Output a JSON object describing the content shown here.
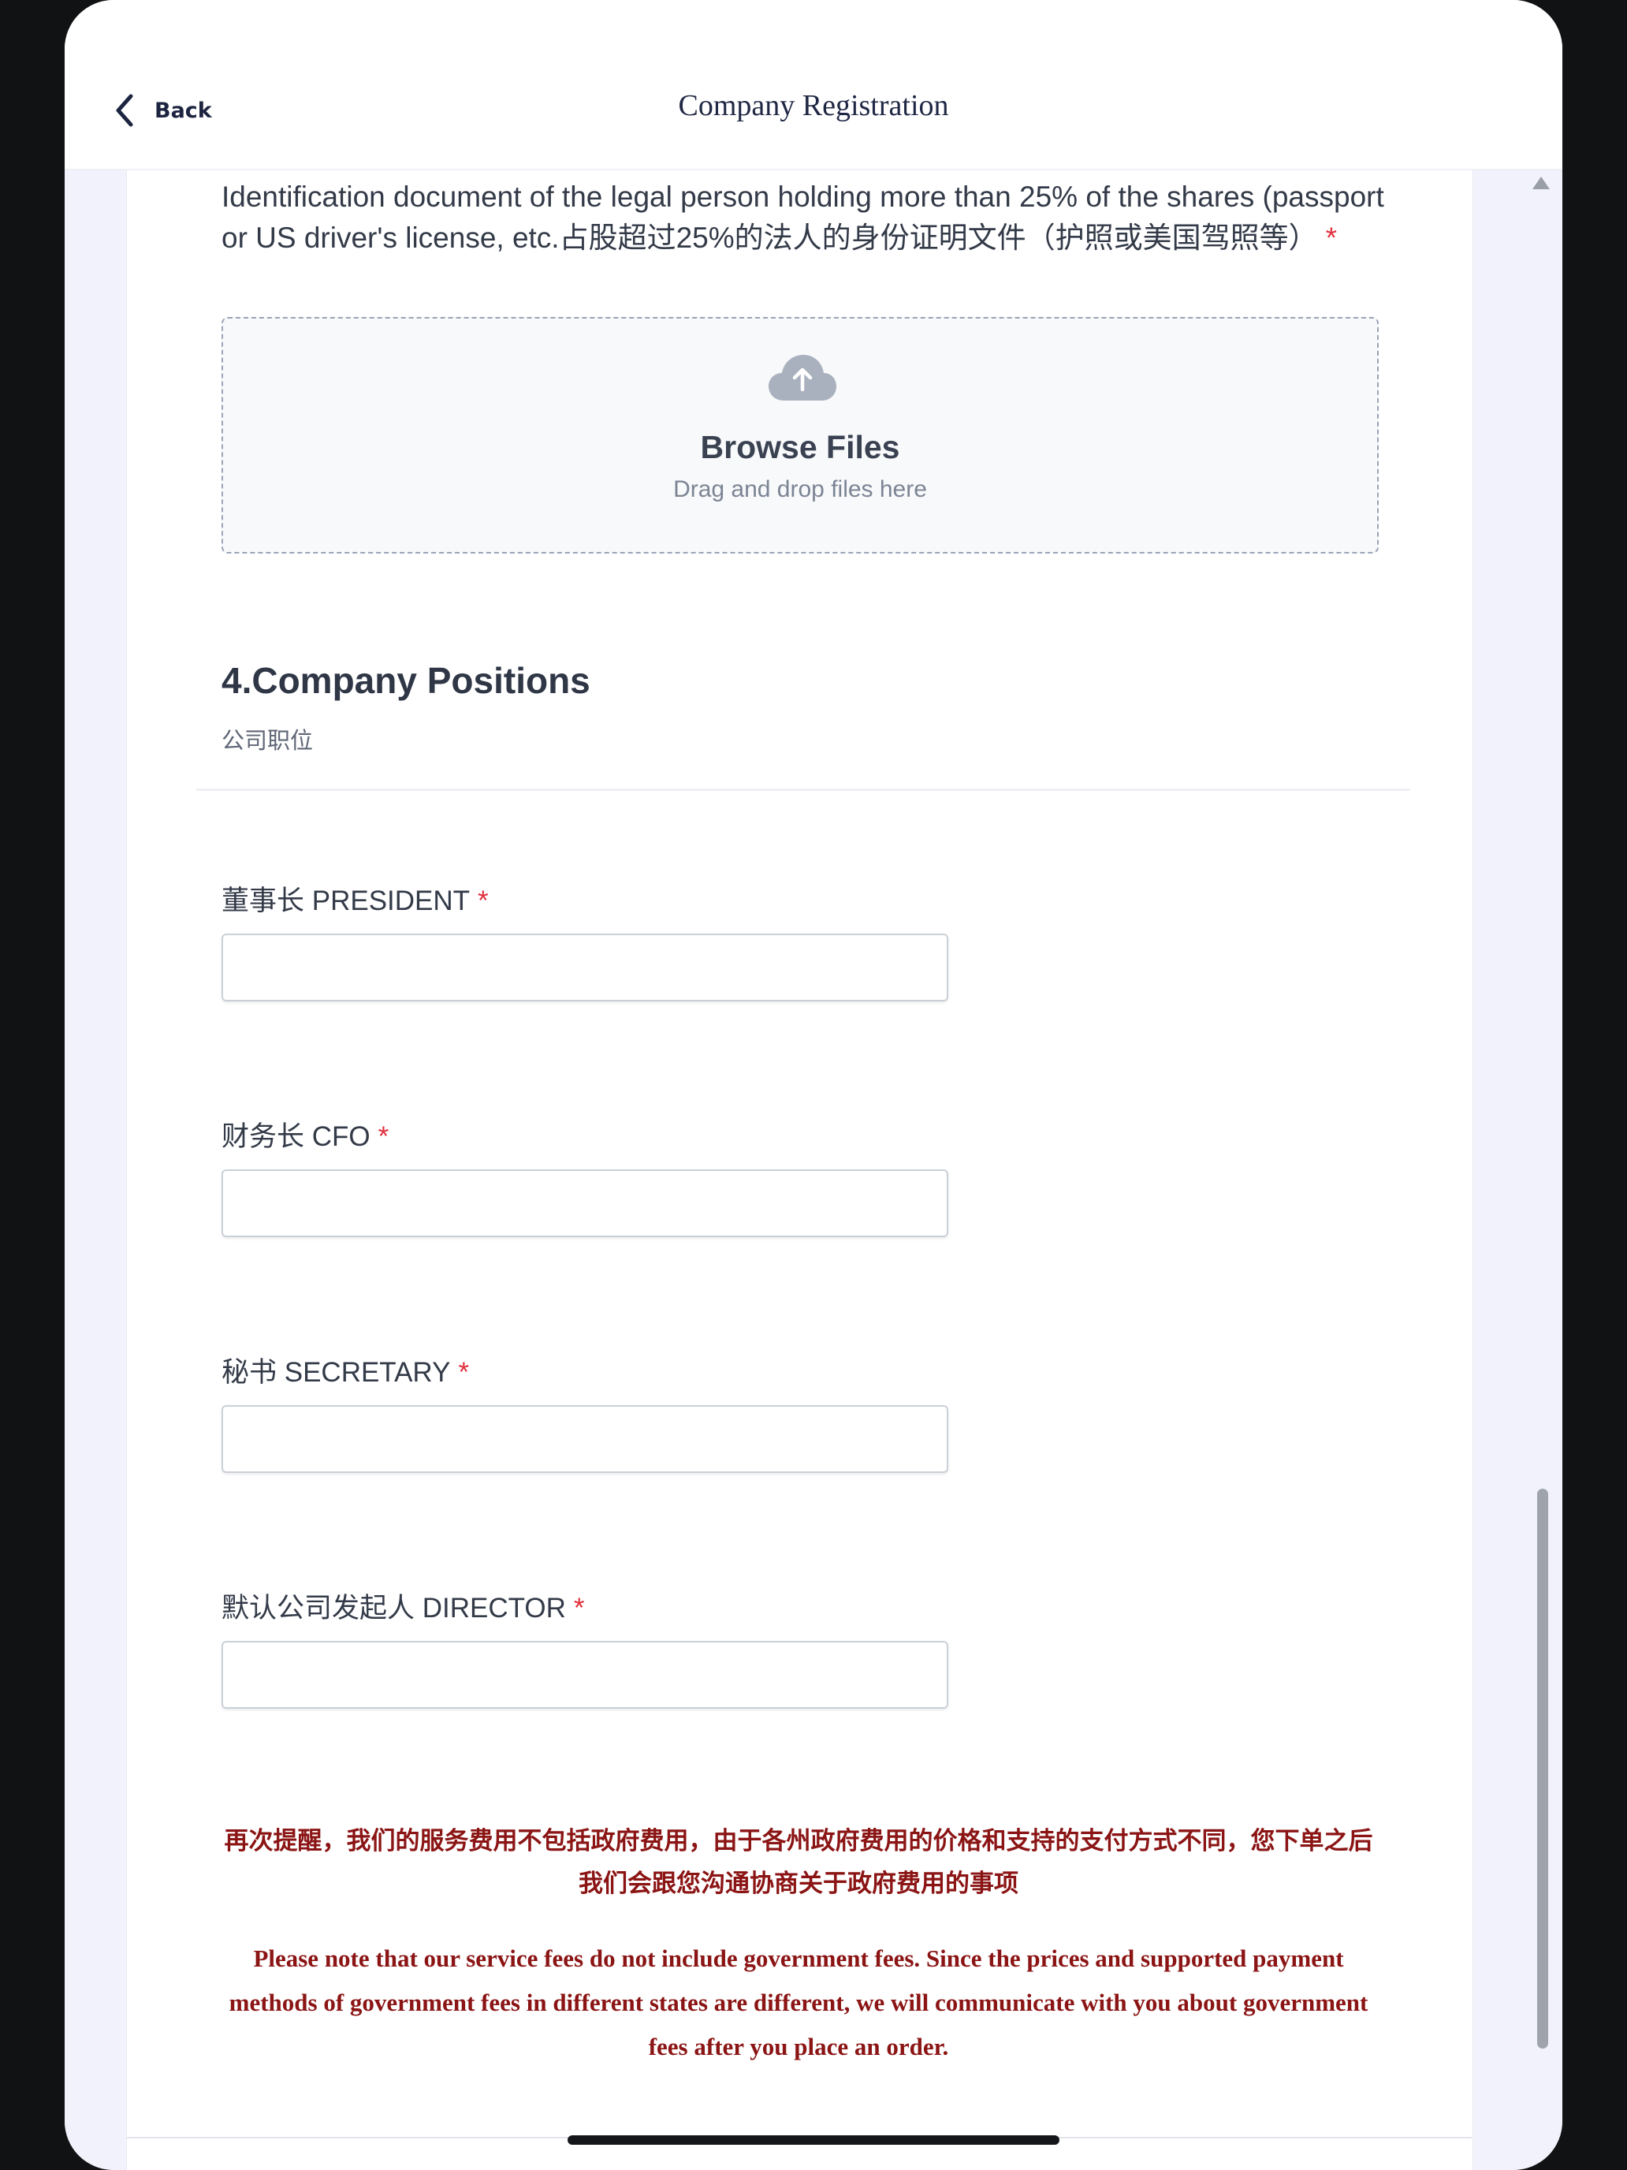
{
  "nav": {
    "back_label": "Back",
    "title": "Company Registration"
  },
  "document_upload": {
    "label": "Identification document of the legal person holding more than 25% of the shares (passport or US driver's license, etc.占股超过25%的法人的身份证明文件（护照或美国驾照等）",
    "required_mark": "*",
    "browse_label": "Browse Files",
    "drag_hint": "Drag and drop files here"
  },
  "section": {
    "title": "4.Company Positions",
    "subtitle": "公司职位"
  },
  "fields": {
    "president": {
      "label": "董事长 PRESIDENT",
      "required_mark": "*",
      "value": "",
      "placeholder": ""
    },
    "cfo": {
      "label": "财务长 CFO",
      "required_mark": "*",
      "value": "",
      "placeholder": ""
    },
    "secretary": {
      "label": "秘书 SECRETARY",
      "required_mark": "*",
      "value": "",
      "placeholder": ""
    },
    "director": {
      "label": "默认公司发起人 DIRECTOR",
      "required_mark": "*",
      "value": "",
      "placeholder": ""
    }
  },
  "notice": {
    "chinese": "再次提醒，我们的服务费用不包括政府费用，由于各州政府费用的价格和支持的支付方式不同，您下单之后我们会跟您沟通协商关于政府费用的事项",
    "english": "Please note that our service fees do not include government fees. Since the prices and supported payment methods of government fees in different states are different, we will communicate with you about government fees after you place an order.",
    "color": "#8b1414"
  },
  "colors": {
    "required": "#e0303c",
    "side_background": "#f1f2fb",
    "upload_icon": "#a9b1bf"
  },
  "icons": {
    "back": "chevron-left-icon",
    "upload": "cloud-upload-icon"
  }
}
